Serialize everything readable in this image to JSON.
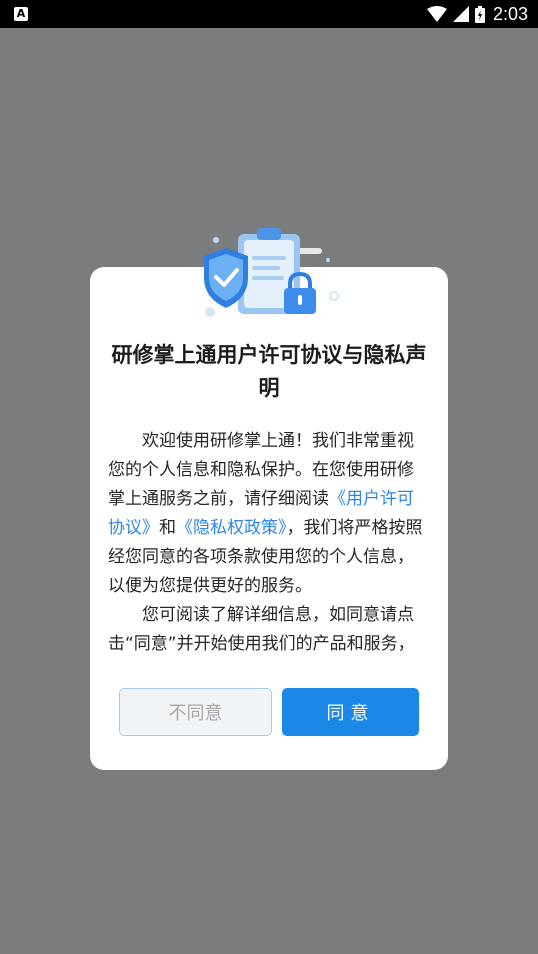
{
  "status_bar": {
    "left_icon": "A",
    "time": "2:03",
    "icons": [
      "wifi-icon",
      "signal-icon",
      "battery-icon"
    ]
  },
  "dialog": {
    "title": "研修掌上通用户许可协议与隐私声明",
    "paragraph1": {
      "part1": "欢迎使用研修掌上通！我们非常重视您的个人信息和隐私保护。在您使用研修掌上通服务之前，请仔细阅读",
      "link1": "《用户许可协议》",
      "part2": "和",
      "link2": "《隐私权政策》",
      "part3": "，我们将严格按照经您同意的各项条款使用您的个人信息，以便为您提供更好的服务。"
    },
    "paragraph2": "您可阅读了解详细信息，如同意请点击“同意”并开始使用我们的产品和服务，",
    "disagree_label": "不同意",
    "agree_label": "同意",
    "colors": {
      "accent": "#1988e6",
      "link": "#2e86e8",
      "overlay": "#7b7c7e"
    }
  }
}
